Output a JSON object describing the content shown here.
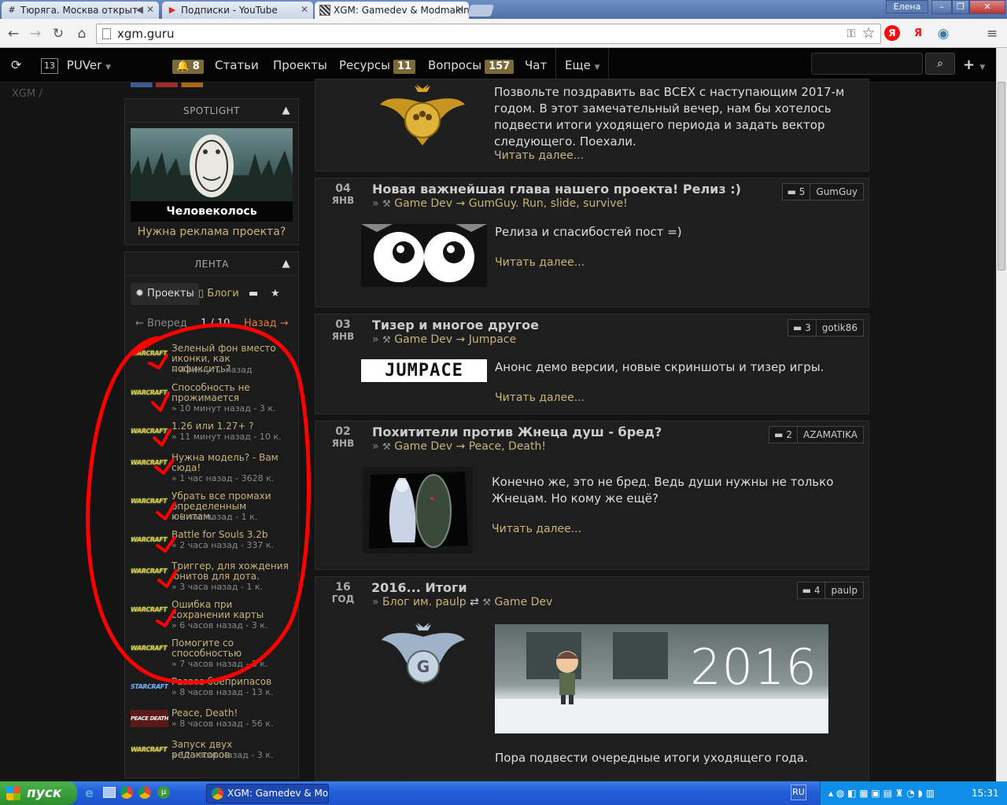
{
  "browser": {
    "tabs": [
      {
        "title": "Тюряга. Москва открыт"
      },
      {
        "title": "Подписки - YouTube"
      },
      {
        "title": "XGM: Gamedev & Modmakin"
      }
    ],
    "profile": "Елена",
    "url": "xgm.guru"
  },
  "nav": {
    "user": "PUVer",
    "avatar_text": "13",
    "bell_count": "8",
    "items": [
      {
        "label": "Статьи",
        "badge": ""
      },
      {
        "label": "Проекты",
        "badge": ""
      },
      {
        "label": "Ресурсы",
        "badge": "11"
      },
      {
        "label": "Вопросы",
        "badge": "157"
      },
      {
        "label": "Чат",
        "badge": ""
      },
      {
        "label": "Еще",
        "badge": ""
      }
    ]
  },
  "breadcrumb": "XGM /",
  "spotlight": {
    "header": "SPOTLIGHT",
    "caption": "Человеколось",
    "ad_link": "Нужна реклама проекта?"
  },
  "feed": {
    "header": "ЛЕНТА",
    "tabs": [
      "Проекты",
      "Блоги"
    ],
    "prev": "← Вперед",
    "page": "1 / 10",
    "next": "Назад →",
    "items": [
      {
        "icon": "WARCRAFT",
        "title": "Зеленый фон вместо иконки, как пофиксить?",
        "meta": "» 4 минуты назад"
      },
      {
        "icon": "WARCRAFT",
        "title": "Способность не прожимается",
        "meta": "» 10 минут назад - 3 к."
      },
      {
        "icon": "WARCRAFT",
        "title": "1.26 или 1.27+ ?",
        "meta": "» 11 минут назад - 10 к."
      },
      {
        "icon": "WARCRAFT",
        "title": "Нужна модель? - Вам сюда!",
        "meta": "» 1 час назад - 3628 к."
      },
      {
        "icon": "WARCRAFT",
        "title": "Убрать все промахи определенным юнитам.",
        "meta": "» 1 час назад - 1 к."
      },
      {
        "icon": "WARCRAFT",
        "title": "Battle for Souls 3.2b",
        "meta": "» 2 часа назад - 337 к."
      },
      {
        "icon": "WARCRAFT",
        "title": "Триггер, для хождения юнитов для дота.",
        "meta": "» 3 часа назад - 1 к."
      },
      {
        "icon": "WARCRAFT",
        "title": "Ошибка при сохранении карты",
        "meta": "» 6 часов назад - 3 к."
      },
      {
        "icon": "WARCRAFT",
        "title": "Помогите со способностью",
        "meta": "» 7 часов назад - 3 к."
      },
      {
        "icon": "STARCRAFT",
        "title": "Развоз боеприпасов",
        "meta": "» 8 часов назад - 13 к."
      },
      {
        "icon": "PEACE DEATH",
        "title": "Peace, Death!",
        "meta": "» 8 часов назад - 56 к."
      },
      {
        "icon": "WARCRAFT",
        "title": "Запуск двух редакторов",
        "meta": "» 12 часов назад - 3 к."
      }
    ]
  },
  "posts": {
    "top": {
      "text": "Позвольте поздравить вас ВСЕХ с наступающим 2017-м годом. В этот замечательный вечер, нам бы хотелось подвести итоги уходящего периода и задать вектор следующего. Поехали.",
      "readmore": "Читать далее..."
    },
    "p1": {
      "day": "04",
      "mon": "ЯНВ",
      "title": "Новая важнейшая глава нашего проекта! Релиз :)",
      "path": "Game Dev → GumGuy. Run, slide, survive!",
      "count": "5",
      "user": "GumGuy",
      "text": "Релиза и спасибостей пост =)",
      "readmore": "Читать далее..."
    },
    "p2": {
      "day": "03",
      "mon": "ЯНВ",
      "title": "Тизер и многое другое",
      "path": "Game Dev → Jumpace",
      "count": "3",
      "user": "gotik86",
      "logo": "JUMPACE",
      "text": "Анонс демо версии, новые скриншоты и тизер игры.",
      "readmore": "Читать далее..."
    },
    "p3": {
      "day": "02",
      "mon": "ЯНВ",
      "title": "Похитители против Жнеца душ - бред?",
      "path": "Game Dev → Peace, Death!",
      "count": "2",
      "user": "AZAMATIKA",
      "text": "Конечно же, это не бред. Ведь души нужны не только Жнецам. Но кому же ещё?",
      "readmore": "Читать далее..."
    },
    "p4": {
      "day": "16",
      "mon": "ГОД",
      "title": "2016... Итоги",
      "path_blog": "Блог им. paulp",
      "path_gd": "Game Dev",
      "count": "4",
      "user": "paulp",
      "banner": "2016",
      "text": "Пора подвести очередные итоги уходящего года."
    }
  },
  "taskbar": {
    "start": "пуск",
    "task": "XGM: Gamedev & Mo...",
    "lang": "RU",
    "clock": "15:31"
  },
  "colors": {
    "accent": "#c9b27a",
    "annotation": "#ff0000",
    "bg": "#141414"
  }
}
